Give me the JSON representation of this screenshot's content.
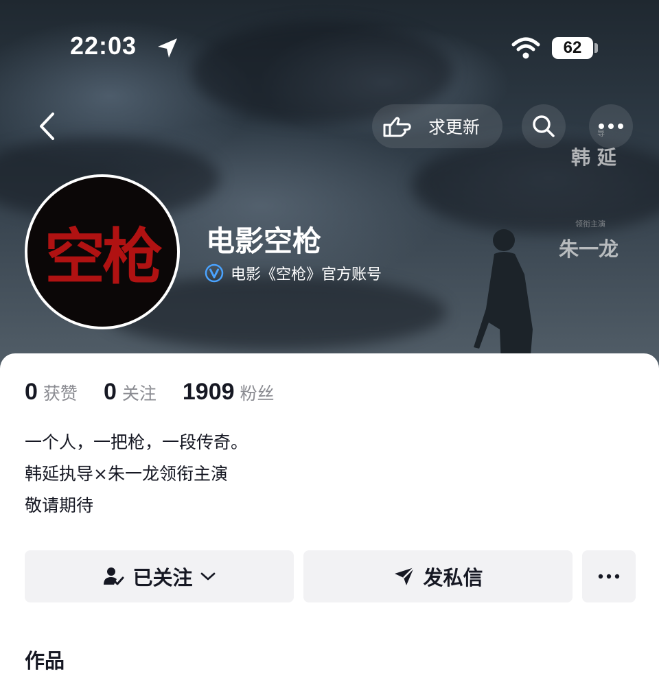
{
  "status_bar": {
    "time": "22:03",
    "battery": "62"
  },
  "nav": {
    "update_label": "求更新"
  },
  "poster": {
    "director_small": "导",
    "director": "韩 延",
    "actor_small": "领衔主演",
    "actor": "朱一龙"
  },
  "profile": {
    "avatar_text": "空枪",
    "name": "电影空枪",
    "verified_text": "电影《空枪》官方账号"
  },
  "stats": [
    {
      "value": "0",
      "label": "获赞"
    },
    {
      "value": "0",
      "label": "关注"
    },
    {
      "value": "1909",
      "label": "粉丝"
    }
  ],
  "bio": [
    "一个人，一把枪，一段传奇。",
    "韩延执导×朱一龙领衔主演",
    "敬请期待"
  ],
  "actions": {
    "follow_label": "已关注",
    "message_label": "发私信"
  },
  "works": {
    "label": "作品"
  },
  "icons": [
    "location-arrow-icon",
    "wifi-icon",
    "back-icon",
    "hand-point-icon",
    "search-icon",
    "more-icon",
    "verified-icon",
    "followed-user-icon",
    "chevron-down-icon",
    "send-icon"
  ],
  "colors": {
    "verified_blue": "#4aa3ff",
    "avatar_red": "#b01212",
    "button_bg": "#f2f2f4",
    "muted_text": "#8a8b91"
  }
}
